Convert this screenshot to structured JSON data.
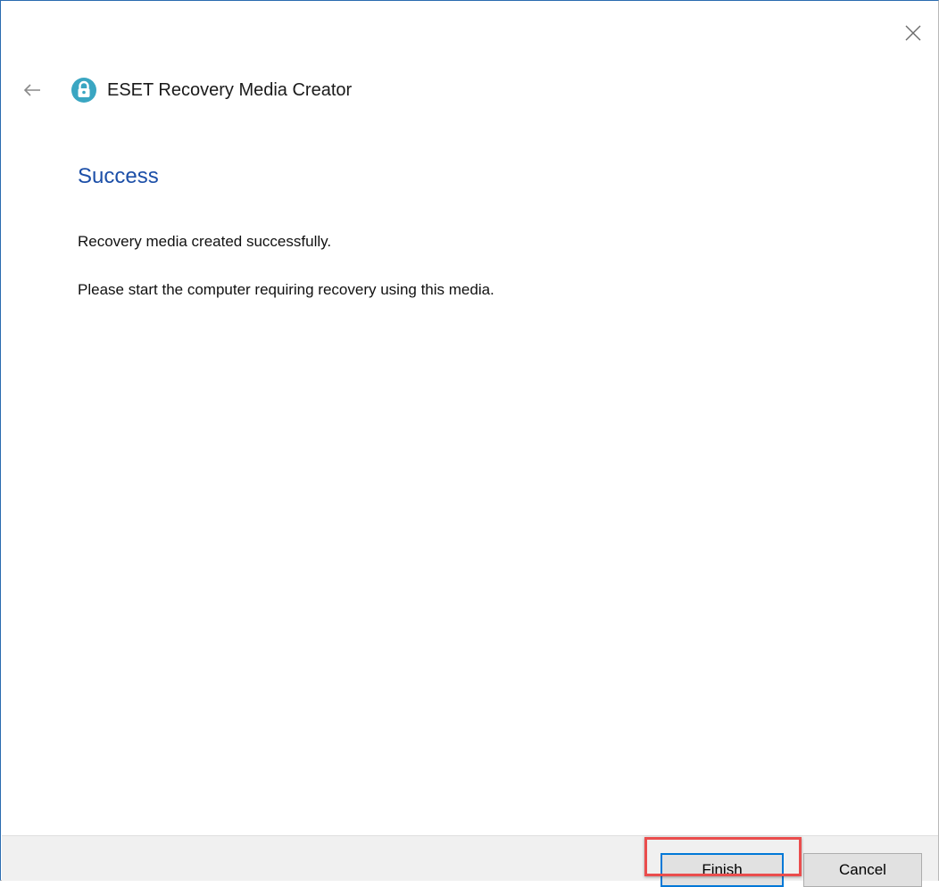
{
  "window": {
    "close_icon": "close-icon"
  },
  "header": {
    "back_icon": "back-arrow-icon",
    "app_icon": "eset-logo-icon",
    "app_title": "ESET Recovery Media Creator"
  },
  "content": {
    "title": "Success",
    "messages": [
      "Recovery media created successfully.",
      "Please start the computer requiring recovery using this media."
    ]
  },
  "footer": {
    "finish_label": "Finish",
    "cancel_label": "Cancel"
  },
  "colors": {
    "title_blue": "#1c4fa8",
    "eset_teal": "#3aa6c2",
    "focus_blue": "#0078d7",
    "highlight_red": "#ea4d4d",
    "footer_bg": "#f0f0f0"
  }
}
